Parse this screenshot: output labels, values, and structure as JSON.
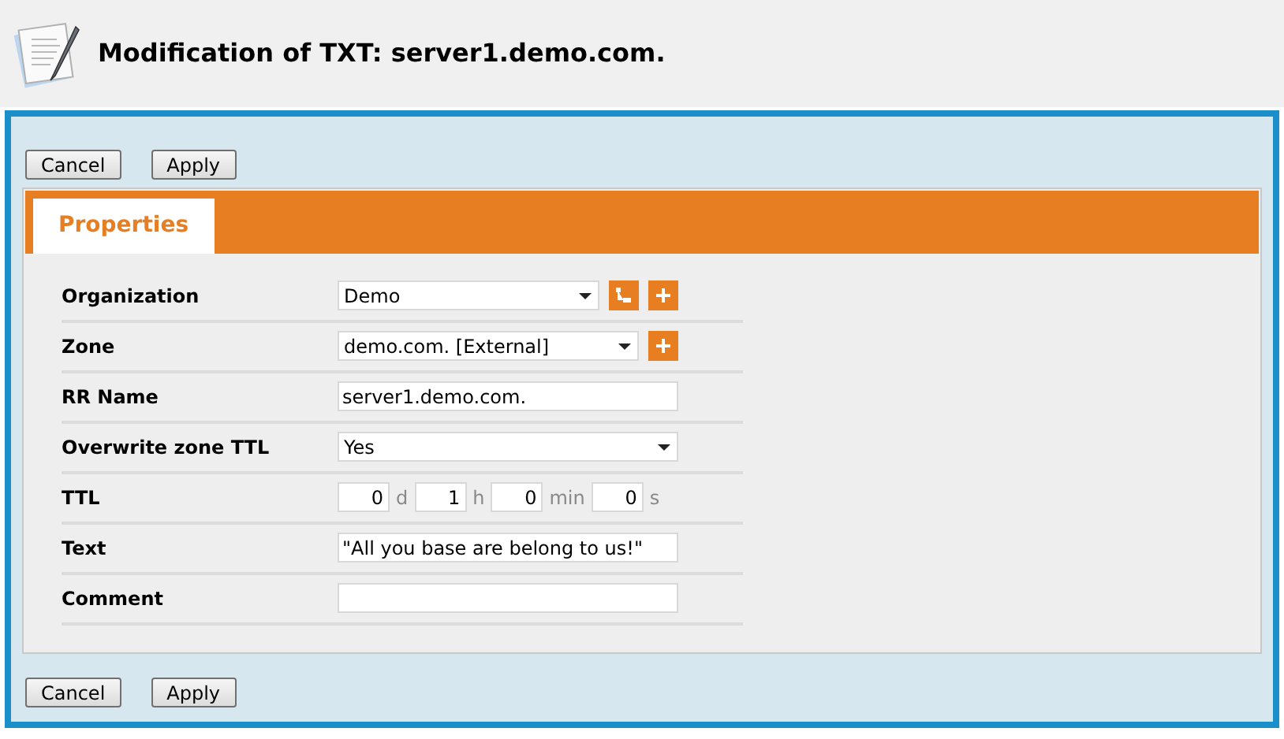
{
  "header": {
    "title": "Modification of TXT: server1.demo.com."
  },
  "top_buttons": [
    "Cancel",
    "Apply"
  ],
  "tabs": [
    {
      "label": "Properties",
      "selected": true
    }
  ],
  "rows": [
    {
      "kind": "select",
      "label": "Organization",
      "value": "Demo",
      "actions": [
        {
          "kind": "tree"
        },
        {
          "kind": "add"
        }
      ]
    },
    {
      "kind": "select",
      "label": "Zone",
      "value": "demo.com. [External]",
      "actions": [
        {
          "kind": "add"
        }
      ]
    },
    {
      "kind": "text",
      "label": "RR Name",
      "value": "server1.demo.com."
    },
    {
      "kind": "select",
      "label": "Overwrite zone TTL",
      "value": "Yes",
      "actions": []
    },
    {
      "kind": "ttl",
      "label": "TTL",
      "parts": [
        {
          "value": "0",
          "unit": "d"
        },
        {
          "value": "1",
          "unit": "h"
        },
        {
          "value": "0",
          "unit": "min"
        },
        {
          "value": "0",
          "unit": "s"
        }
      ]
    },
    {
      "kind": "text",
      "label": "Text",
      "value": "\"All you base are belong to us!\""
    },
    {
      "kind": "text",
      "label": "Comment",
      "value": ""
    }
  ],
  "bottom_buttons": [
    "Cancel",
    "Apply"
  ]
}
